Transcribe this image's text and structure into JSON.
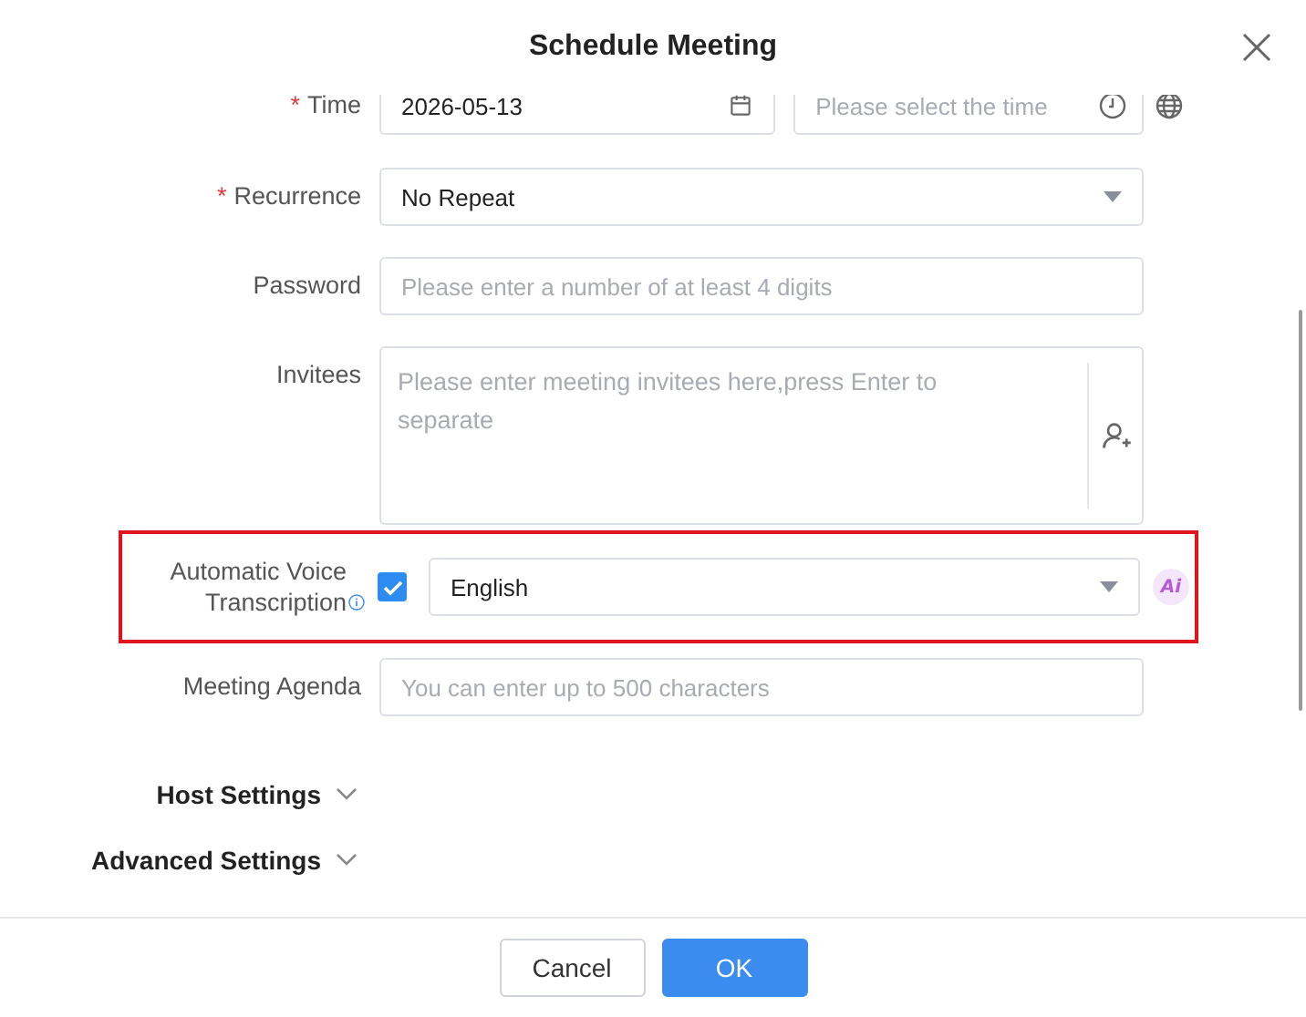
{
  "dialog": {
    "title": "Schedule Meeting"
  },
  "fields": [
    {
      "kind": "datetime",
      "label": "Time",
      "required_mark": "*",
      "value": "2026-05-13",
      "time_placeholder": "Please select the time"
    },
    {
      "kind": "select",
      "label": "Recurrence",
      "required_mark": "*",
      "value": "No Repeat"
    },
    {
      "kind": "text",
      "label": "Password",
      "placeholder": "Please enter a number of at least 4 digits"
    },
    {
      "kind": "textarea",
      "label": "Invitees",
      "placeholder": "Please enter meeting invitees here,press Enter to separate"
    },
    {
      "kind": "transcription",
      "label": "Automatic Voice Transcription",
      "checked": true,
      "value": "English",
      "ai_badge": "Ai",
      "highlighted": true
    },
    {
      "kind": "text",
      "label": "Meeting Agenda",
      "placeholder": "You can enter up to 500 characters"
    }
  ],
  "sections": [
    {
      "label": "Host Settings",
      "expanded": false
    },
    {
      "label": "Advanced Settings",
      "expanded": false
    }
  ],
  "buttons": [
    {
      "label": "Cancel",
      "kind": "secondary"
    },
    {
      "label": "OK",
      "kind": "primary"
    }
  ]
}
